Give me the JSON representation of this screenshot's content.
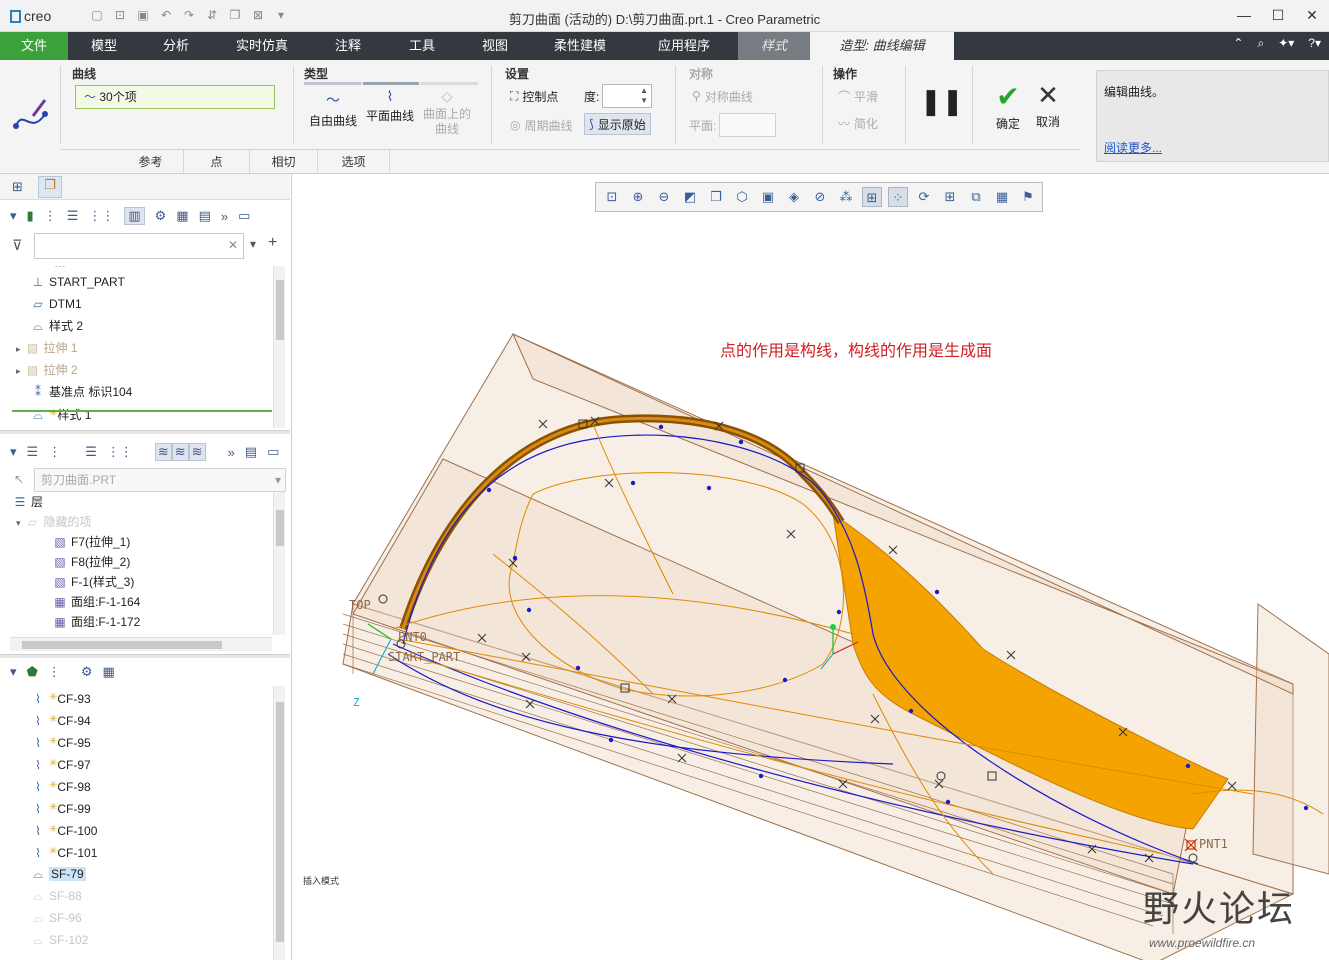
{
  "app": {
    "logo": "creo",
    "window_title": "剪刀曲面 (活动的) D:\\剪刀曲面.prt.1 - Creo Parametric"
  },
  "quick_access": [
    "new-icon",
    "open-icon",
    "save-icon",
    "undo-icon",
    "redo-icon",
    "regenerate-icon",
    "windows-icon",
    "close-window-icon",
    "customize-icon"
  ],
  "window_controls": {
    "minimize": "—",
    "maximize": "☐",
    "close": "✕"
  },
  "tabs": [
    "文件",
    "模型",
    "分析",
    "实时仿真",
    "注释",
    "工具",
    "视图",
    "柔性建模",
    "应用程序",
    "样式",
    "造型: 曲线编辑"
  ],
  "ribbon": {
    "curve_group": {
      "title": "曲线",
      "selection": "30个项"
    },
    "type_group": {
      "title": "类型",
      "free_curve": "自由曲线",
      "plane_curve": "平面曲线",
      "cos_curve": "曲面上的曲线"
    },
    "settings_group": {
      "title": "设置",
      "control_points": "控制点",
      "degree_label": "度:",
      "periodic_curve": "周期曲线",
      "show_original": "显示原始"
    },
    "symmetry_group": {
      "title": "对称",
      "symmetric_curve": "对称曲线",
      "plane_label": "平面:"
    },
    "operations_group": {
      "title": "操作",
      "smooth": "平滑",
      "simplify": "简化"
    },
    "pause_label": "❚❚",
    "ok": "确定",
    "cancel": "取消",
    "subtabs": [
      "参考",
      "点",
      "相切",
      "选项"
    ],
    "help": {
      "text": "编辑曲线。",
      "link": "阅读更多..."
    }
  },
  "model_tree": {
    "items": [
      {
        "icon": "csys-icon",
        "label": "START_PART",
        "style": "normal"
      },
      {
        "icon": "datum-plane-icon",
        "label": "DTM1",
        "style": "normal"
      },
      {
        "icon": "style-feature-icon",
        "label": "样式 2",
        "style": "normal"
      },
      {
        "icon": "extrude-icon",
        "label": "拉伸 1",
        "style": "dim"
      },
      {
        "icon": "extrude-icon",
        "label": "拉伸 2",
        "style": "dim"
      },
      {
        "icon": "datum-point-icon",
        "label": "基准点 标识104",
        "style": "normal"
      },
      {
        "icon": "style-feature-icon",
        "label": "样式 1",
        "style": "normal"
      }
    ]
  },
  "layer_tree": {
    "part": "剪刀曲面.PRT",
    "root": "层",
    "hidden_group": "隐藏的项",
    "items": [
      "F7(拉伸_1)",
      "F8(拉伸_2)",
      "F-1(样式_3)",
      "面组:F-1-164",
      "面组:F-1-172"
    ]
  },
  "style_tree": {
    "items": [
      {
        "label": "CF-93",
        "style": "normal"
      },
      {
        "label": "CF-94",
        "style": "normal"
      },
      {
        "label": "CF-95",
        "style": "normal"
      },
      {
        "label": "CF-97",
        "style": "normal"
      },
      {
        "label": "CF-98",
        "style": "normal"
      },
      {
        "label": "CF-99",
        "style": "normal"
      },
      {
        "label": "CF-100",
        "style": "normal"
      },
      {
        "label": "CF-101",
        "style": "normal"
      },
      {
        "label": "SF-79",
        "style": "selected"
      },
      {
        "label": "SF-88",
        "style": "faded"
      },
      {
        "label": "SF-96",
        "style": "faded"
      },
      {
        "label": "SF-102",
        "style": "faded"
      }
    ]
  },
  "viewport": {
    "annotation": "点的作用是构线，构线的作用是生成面",
    "datum_labels": {
      "top": "TOP",
      "pnt0": "PNT0",
      "start_part": "START_PART",
      "pnt1": "PNT1",
      "z": "Z"
    },
    "status": "插入模式",
    "watermark_text": "野火论坛",
    "watermark_url": "www.proewildfire.cn"
  },
  "colors": {
    "active_tab": "#3ba13b",
    "tab_bar": "#33393f",
    "surface": "#f5a300",
    "curve_blue": "#1a1acc",
    "annotation": "#d21f1f"
  }
}
